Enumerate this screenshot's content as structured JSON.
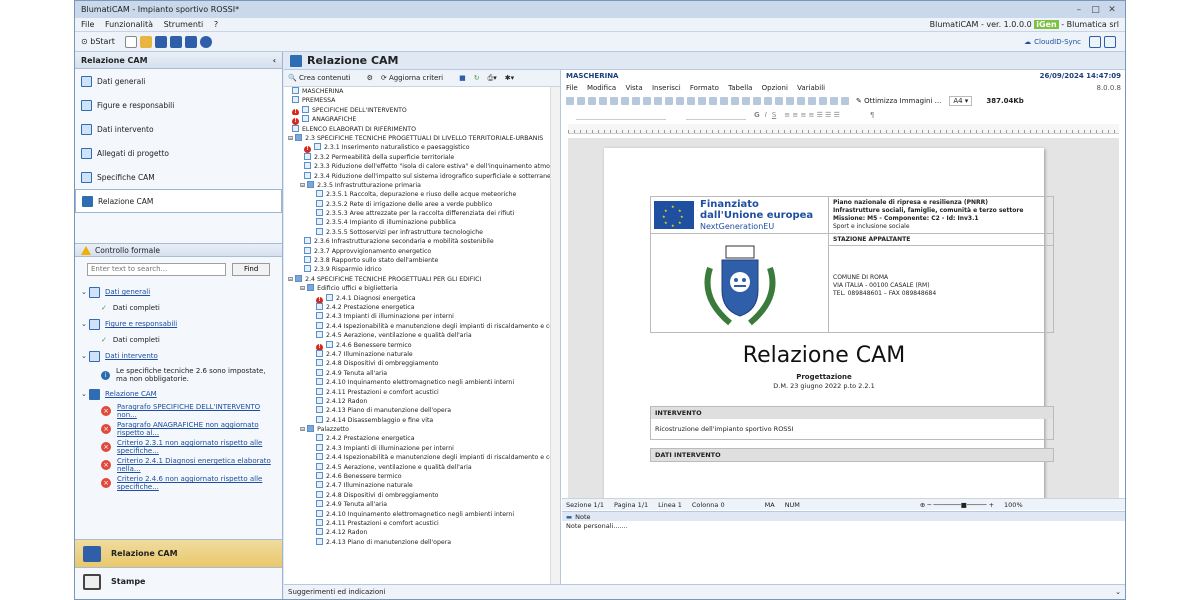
{
  "window": {
    "title": "BlumatiCAM - Impianto sportivo ROSSI*"
  },
  "menubar": {
    "items": [
      "File",
      "Funzionalità",
      "Strumenti",
      "?"
    ],
    "version": "BlumatiCAM - ver. 1.0.0.0",
    "brand": "iGen",
    "brand_suffix": "- Blumatica srl"
  },
  "toolbar": {
    "start_label": "bStart",
    "cloud_label": "CloudID-Sync"
  },
  "left": {
    "title": "Relazione CAM",
    "items": [
      {
        "label": "Dati generali"
      },
      {
        "label": "Figure e responsabili"
      },
      {
        "label": "Dati intervento"
      },
      {
        "label": "Allegati di progetto"
      },
      {
        "label": "Specifiche CAM"
      },
      {
        "label": "Relazione CAM"
      }
    ],
    "control_title": "Controllo formale",
    "search_placeholder": "Enter text to search...",
    "find_label": "Find",
    "checks": {
      "g1": "Dati generali",
      "g1a": "Dati completi",
      "g2": "Figure e responsabili",
      "g2a": "Dati completi",
      "g3": "Dati intervento",
      "g3a": "Le specifiche tecniche 2.6 sono impostate, ma non obbligatorie.",
      "g4": "Relazione CAM",
      "e1": "Paragrafo SPECIFICHE DELL'INTERVENTO non...",
      "e2": "Paragrafo ANAGRAFICHE non aggiornato rispetto al...",
      "e3": "Criterio 2.3.1 non aggiornato rispetto alle specifiche...",
      "e4": "Criterio 2.4.1 Diagnosi energetica elaborato nella...",
      "e5": "Criterio 2.4.6 non aggiornato rispetto alle specifiche..."
    },
    "bottom_nav": [
      "Relazione CAM",
      "Stampe"
    ]
  },
  "center": {
    "title": "Relazione CAM",
    "tree_toolbar": {
      "create": "Crea contenuti",
      "update": "Aggiorna criteri"
    },
    "tree": [
      {
        "t": "MASCHERINA",
        "lv": 0,
        "e": false,
        "f": false
      },
      {
        "t": "PREMESSA",
        "lv": 0,
        "e": false,
        "f": false
      },
      {
        "t": "SPECIFICHE DELL'INTERVENTO",
        "lv": 0,
        "e": true,
        "f": false
      },
      {
        "t": "ANAGRAFICHE",
        "lv": 0,
        "e": true,
        "f": false
      },
      {
        "t": "ELENCO ELABORATI DI RIFERIMENTO",
        "lv": 0,
        "e": false,
        "f": false
      },
      {
        "t": "2.3 SPECIFICHE TECNICHE PROGETTUALI DI LIVELLO TERRITORIALE-URBANIS",
        "lv": 0,
        "e": false,
        "f": true
      },
      {
        "t": "2.3.1 Inserimento naturalistico e paesaggistico",
        "lv": 1,
        "e": true,
        "f": false
      },
      {
        "t": "2.3.2 Permeabilità della superficie territoriale",
        "lv": 1,
        "e": false,
        "f": false
      },
      {
        "t": "2.3.3 Riduzione dell'effetto \"isola di calore estiva\" e dell'inquinamento atmos",
        "lv": 1,
        "e": false,
        "f": false
      },
      {
        "t": "2.3.4 Riduzione dell'impatto sul sistema idrografico superficiale e sotterrane",
        "lv": 1,
        "e": false,
        "f": false
      },
      {
        "t": "2.3.5 Infrastrutturazione primaria",
        "lv": 1,
        "e": false,
        "f": true
      },
      {
        "t": "2.3.5.1 Raccolta, depurazione e riuso delle acque meteoriche",
        "lv": 2,
        "e": false,
        "f": false
      },
      {
        "t": "2.3.5.2 Rete di irrigazione delle aree a verde pubblico",
        "lv": 2,
        "e": false,
        "f": false
      },
      {
        "t": "2.3.5.3 Aree attrezzate per la raccolta differenziata dei rifiuti",
        "lv": 2,
        "e": false,
        "f": false
      },
      {
        "t": "2.3.5.4 Impianto di illuminazione pubblica",
        "lv": 2,
        "e": false,
        "f": false
      },
      {
        "t": "2.3.5.5 Sottoservizi per infrastrutture tecnologiche",
        "lv": 2,
        "e": false,
        "f": false
      },
      {
        "t": "2.3.6 Infrastrutturazione secondaria e mobilità sostenibile",
        "lv": 1,
        "e": false,
        "f": false
      },
      {
        "t": "2.3.7 Approvvigionamento energetico",
        "lv": 1,
        "e": false,
        "f": false
      },
      {
        "t": "2.3.8 Rapporto sullo stato dell'ambiente",
        "lv": 1,
        "e": false,
        "f": false
      },
      {
        "t": "2.3.9 Risparmio idrico",
        "lv": 1,
        "e": false,
        "f": false
      },
      {
        "t": "2.4 SPECIFICHE TECNICHE PROGETTUALI PER GLI EDIFICI",
        "lv": 0,
        "e": false,
        "f": true
      },
      {
        "t": "Edificio uffici e biglietteria",
        "lv": 1,
        "e": false,
        "f": true
      },
      {
        "t": "2.4.1 Diagnosi energetica",
        "lv": 2,
        "e": true,
        "f": false
      },
      {
        "t": "2.4.2 Prestazione energetica",
        "lv": 2,
        "e": false,
        "f": false
      },
      {
        "t": "2.4.3 Impianti di illuminazione per interni",
        "lv": 2,
        "e": false,
        "f": false
      },
      {
        "t": "2.4.4 Ispezionabilità e manutenzione degli impianti di riscaldamento e co",
        "lv": 2,
        "e": false,
        "f": false
      },
      {
        "t": "2.4.5 Aerazione, ventilazione e qualità dell'aria",
        "lv": 2,
        "e": false,
        "f": false
      },
      {
        "t": "2.4.6 Benessere termico",
        "lv": 2,
        "e": true,
        "f": false
      },
      {
        "t": "2.4.7 Illuminazione naturale",
        "lv": 2,
        "e": false,
        "f": false
      },
      {
        "t": "2.4.8 Dispositivi di ombreggiamento",
        "lv": 2,
        "e": false,
        "f": false
      },
      {
        "t": "2.4.9 Tenuta all'aria",
        "lv": 2,
        "e": false,
        "f": false
      },
      {
        "t": "2.4.10 Inquinamento elettromagnetico negli ambienti interni",
        "lv": 2,
        "e": false,
        "f": false
      },
      {
        "t": "2.4.11 Prestazioni e comfort acustici",
        "lv": 2,
        "e": false,
        "f": false
      },
      {
        "t": "2.4.12 Radon",
        "lv": 2,
        "e": false,
        "f": false
      },
      {
        "t": "2.4.13 Piano di manutenzione dell'opera",
        "lv": 2,
        "e": false,
        "f": false
      },
      {
        "t": "2.4.14 Disassemblaggio e fine vita",
        "lv": 2,
        "e": false,
        "f": false
      },
      {
        "t": "Palazzetto",
        "lv": 1,
        "e": false,
        "f": true
      },
      {
        "t": "2.4.2 Prestazione energetica",
        "lv": 2,
        "e": false,
        "f": false
      },
      {
        "t": "2.4.3 Impianti di illuminazione per interni",
        "lv": 2,
        "e": false,
        "f": false
      },
      {
        "t": "2.4.4 Ispezionabilità e manutenzione degli impianti di riscaldamento e co",
        "lv": 2,
        "e": false,
        "f": false
      },
      {
        "t": "2.4.5 Aerazione, ventilazione e qualità dell'aria",
        "lv": 2,
        "e": false,
        "f": false
      },
      {
        "t": "2.4.6 Benessere termico",
        "lv": 2,
        "e": false,
        "f": false
      },
      {
        "t": "2.4.7 Illuminazione naturale",
        "lv": 2,
        "e": false,
        "f": false
      },
      {
        "t": "2.4.8 Dispositivi di ombreggiamento",
        "lv": 2,
        "e": false,
        "f": false
      },
      {
        "t": "2.4.9 Tenuta all'aria",
        "lv": 2,
        "e": false,
        "f": false
      },
      {
        "t": "2.4.10 Inquinamento elettromagnetico negli ambienti interni",
        "lv": 2,
        "e": false,
        "f": false
      },
      {
        "t": "2.4.11 Prestazioni e comfort acustici",
        "lv": 2,
        "e": false,
        "f": false
      },
      {
        "t": "2.4.12 Radon",
        "lv": 2,
        "e": false,
        "f": false
      },
      {
        "t": "2.4.13 Piano di manutenzione dell'opera",
        "lv": 2,
        "e": false,
        "f": false
      }
    ],
    "footer": "Suggerimenti ed indicazioni"
  },
  "editor": {
    "doc_name": "MASCHERINA",
    "datetime": "26/09/2024 14:47:09",
    "version": "8.0.0.8",
    "menu": [
      "File",
      "Modifica",
      "Vista",
      "Inserisci",
      "Formato",
      "Tabella",
      "Opzioni",
      "Variabili"
    ],
    "optimize": "Ottimizza Immagini ...",
    "paper": "A4",
    "size": "387.04Kb",
    "page": {
      "eu_line1": "Finanziato",
      "eu_line2": "dall'Unione europea",
      "eu_line3": "NextGenerationEU",
      "pnrr1": "Piano nazionale di ripresa e resilienza (PNRR)",
      "pnrr2": "Infrastrutture sociali, famiglie, comunità e terzo settore",
      "pnrr3": "Missione: M5 - Componente: C2 - Id: Inv3.1",
      "pnrr4": "Sport e inclusione sociale",
      "stazione": "STAZIONE APPALTANTE",
      "comune": "COMUNE DI ROMA",
      "via": "VIA ITALIA - 00100 CASALE (RM)",
      "tel": "TEL. 089848601 – FAX 089848684",
      "title": "Relazione CAM",
      "subtitle": "Progettazione",
      "dm": "D.M. 23 giugno 2022 p.to 2.2.1",
      "intervento_h": "INTERVENTO",
      "intervento_v": "Ricostruzione dell'impianto sportivo ROSSI",
      "dati_h": "DATI INTERVENTO"
    },
    "status": {
      "sezione": "Sezione 1/1",
      "pagina": "Pagina 1/1",
      "linea": "Linea 1",
      "colonna": "Colonna 0",
      "ma": "MA",
      "num": "NUM",
      "zoom": "100%"
    },
    "notes_title": "Note",
    "notes_text": "Note personali......."
  }
}
